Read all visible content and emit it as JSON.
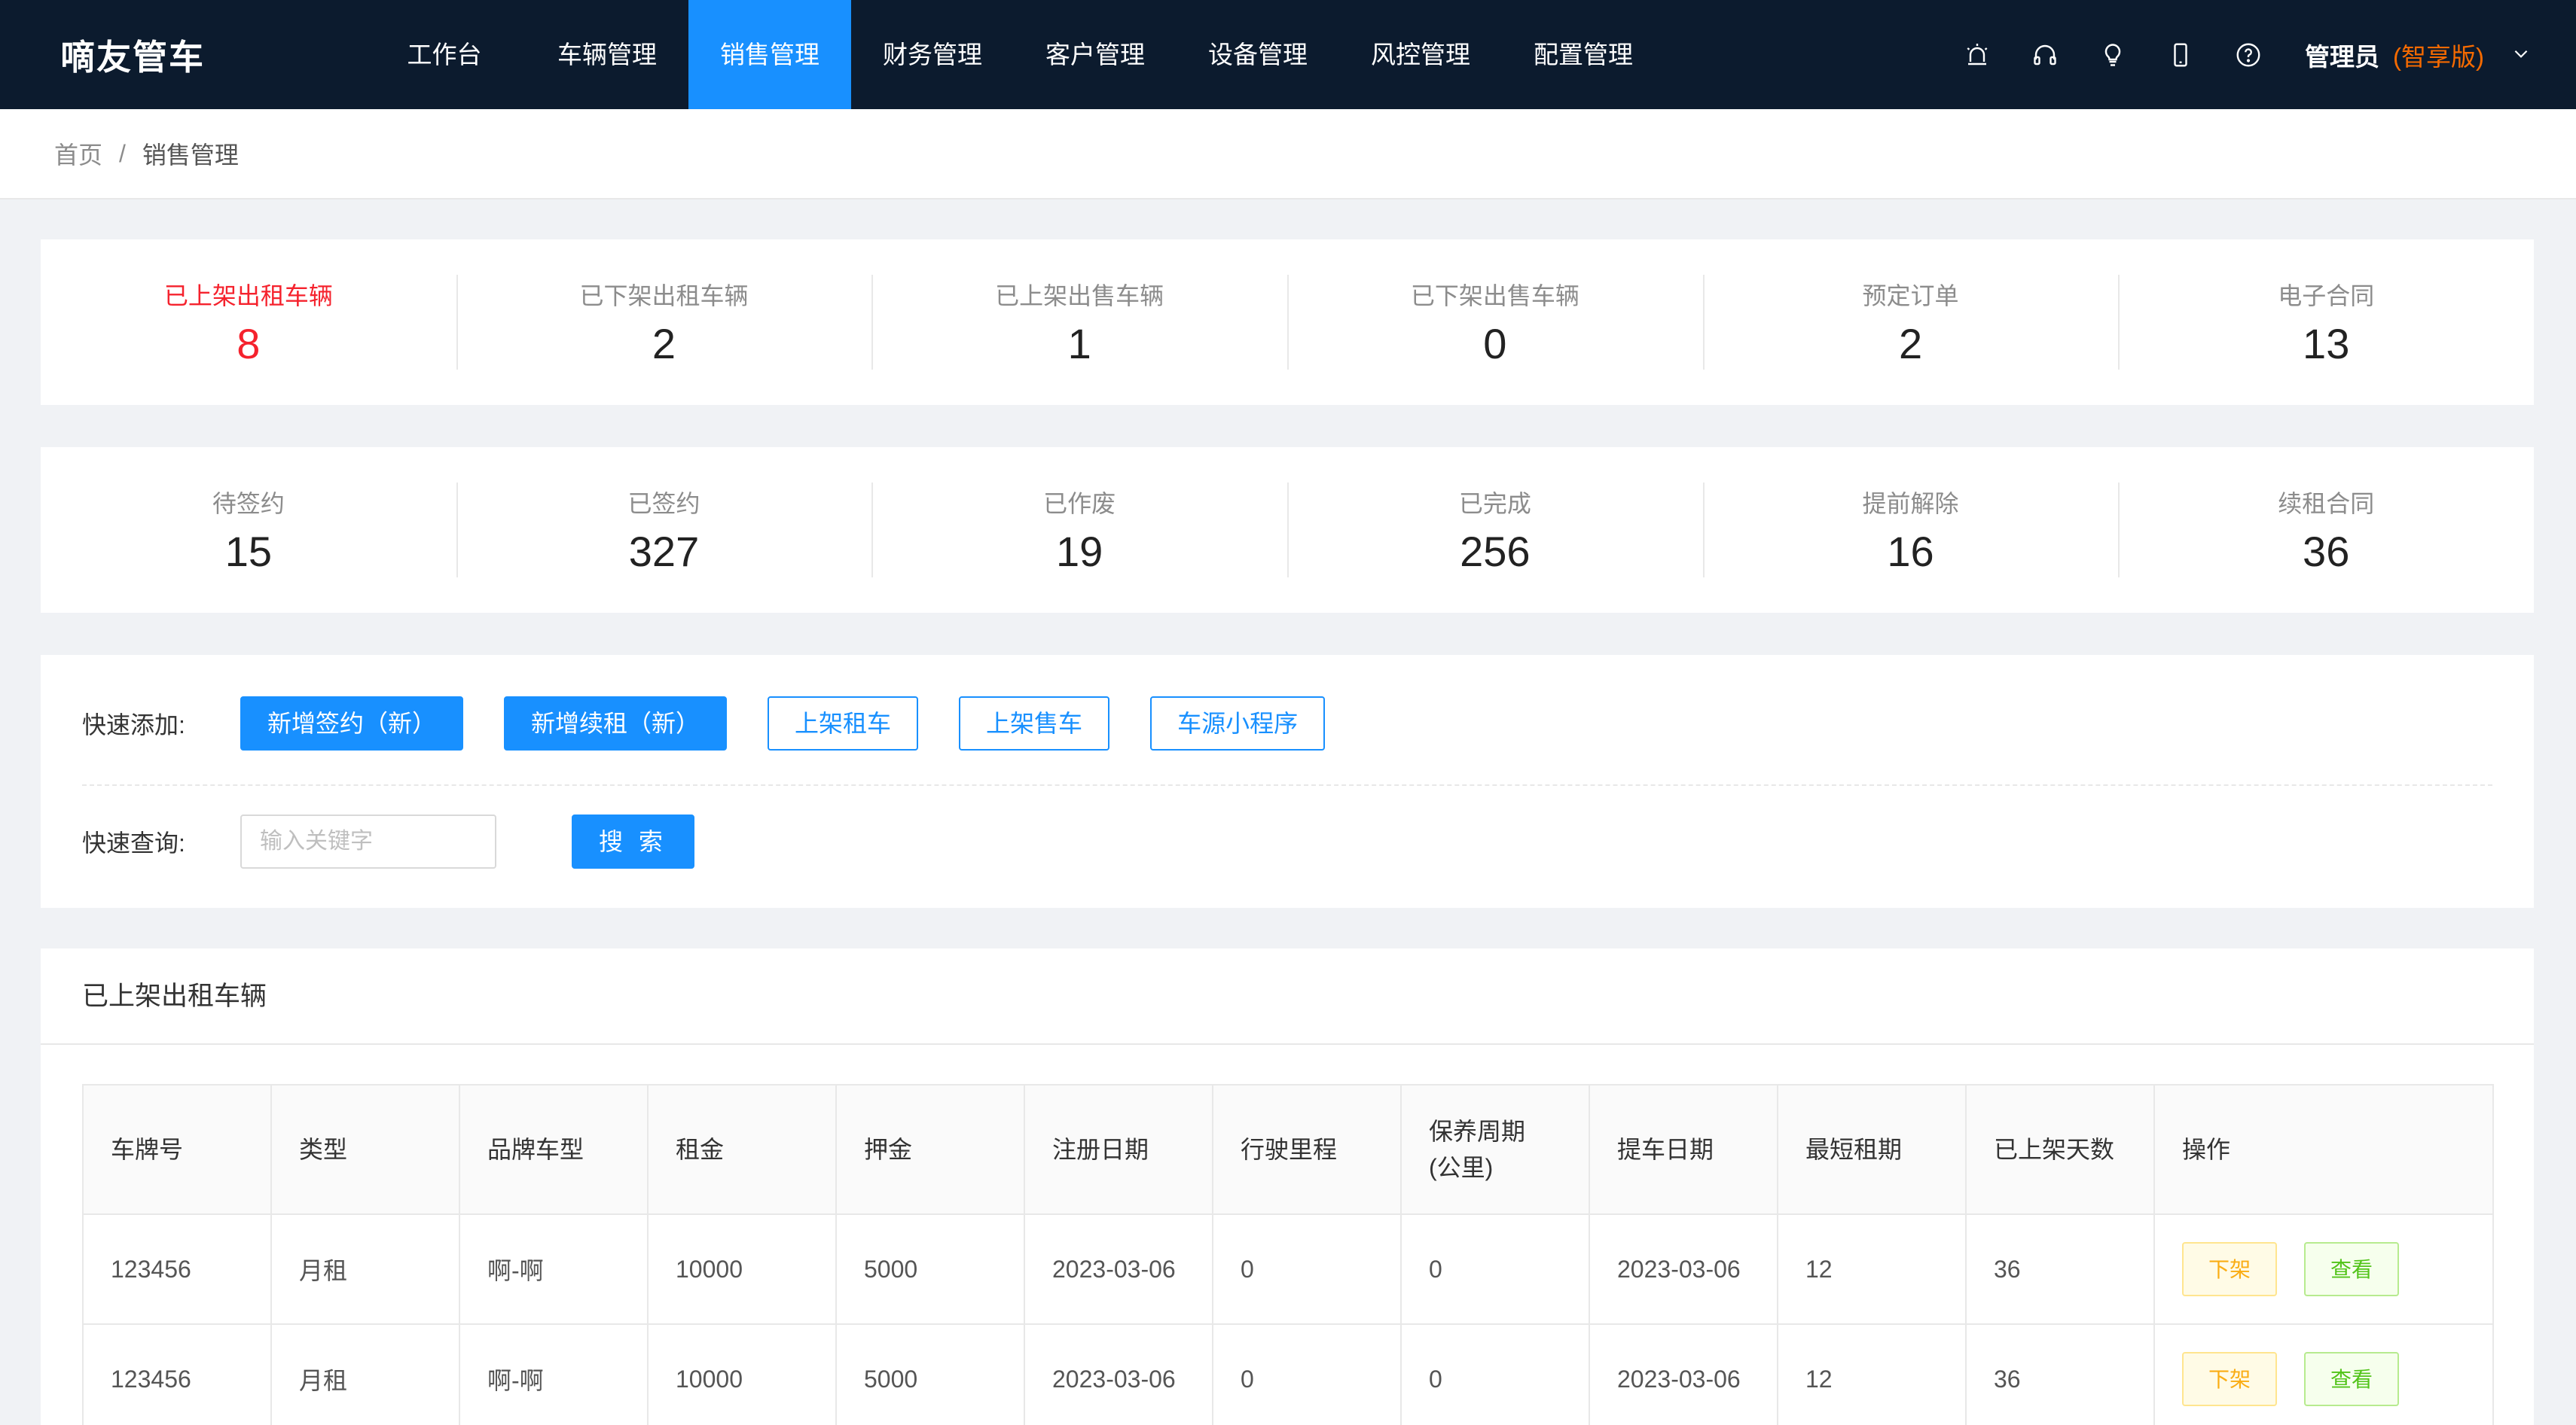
{
  "app": {
    "logo": "嘀友管车"
  },
  "nav": {
    "items": [
      "工作台",
      "车辆管理",
      "销售管理",
      "财务管理",
      "客户管理",
      "设备管理",
      "风控管理",
      "配置管理"
    ],
    "active_index": 2
  },
  "header_icons": [
    "alarm-icon",
    "headset-icon",
    "lightbulb-icon",
    "mobile-icon",
    "help-icon"
  ],
  "user": {
    "name": "管理员",
    "edition": "(智享版)"
  },
  "breadcrumb": {
    "home": "首页",
    "separator": "/",
    "current": "销售管理"
  },
  "stats_row1": [
    {
      "label": "已上架出租车辆",
      "value": "8"
    },
    {
      "label": "已下架出租车辆",
      "value": "2"
    },
    {
      "label": "已上架出售车辆",
      "value": "1"
    },
    {
      "label": "已下架出售车辆",
      "value": "0"
    },
    {
      "label": "预定订单",
      "value": "2"
    },
    {
      "label": "电子合同",
      "value": "13"
    }
  ],
  "stats_row2": [
    {
      "label": "待签约",
      "value": "15"
    },
    {
      "label": "已签约",
      "value": "327"
    },
    {
      "label": "已作废",
      "value": "19"
    },
    {
      "label": "已完成",
      "value": "256"
    },
    {
      "label": "提前解除",
      "value": "16"
    },
    {
      "label": "续租合同",
      "value": "36"
    }
  ],
  "quick_add": {
    "label": "快速添加:",
    "buttons": [
      "新增签约（新）",
      "新增续租（新）",
      "上架租车",
      "上架售车",
      "车源小程序"
    ]
  },
  "quick_search": {
    "label": "快速查询:",
    "placeholder": "输入关键字",
    "button": "搜 索"
  },
  "table": {
    "title": "已上架出租车辆",
    "columns": [
      "车牌号",
      "类型",
      "品牌车型",
      "租金",
      "押金",
      "注册日期",
      "行驶里程",
      "保养周期\n(公里)",
      "提车日期",
      "最短租期",
      "已上架天数",
      "操作"
    ],
    "rows": [
      [
        "123456",
        "月租",
        "啊-啊",
        "10000",
        "5000",
        "2023-03-06",
        "0",
        "0",
        "2023-03-06",
        "12",
        "36"
      ],
      [
        "123456",
        "月租",
        "啊-啊",
        "10000",
        "5000",
        "2023-03-06",
        "0",
        "0",
        "2023-03-06",
        "12",
        "36"
      ]
    ],
    "actions": {
      "off_shelf": "下架",
      "view": "查看"
    }
  },
  "colors": {
    "nav_bg": "#0c1b2e",
    "accent": "#1890ff",
    "highlight_red": "#f5222d",
    "edition_orange": "#f56a00"
  }
}
